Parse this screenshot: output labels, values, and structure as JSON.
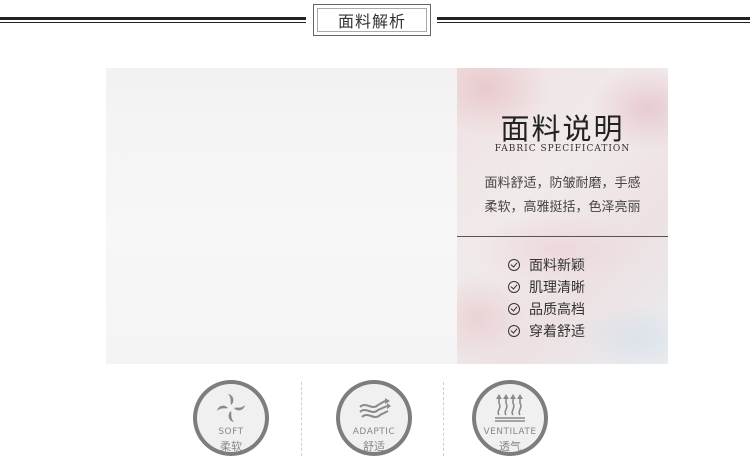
{
  "header": {
    "title": "面料解析"
  },
  "spec": {
    "title": "面料说明",
    "subtitle": "FABRIC SPECIFICATION",
    "desc_line1": "面料舒适，防皱耐磨，手感",
    "desc_line2": "柔软，高雅挺括，色泽亮丽",
    "features": [
      "面料新颖",
      "肌理清晰",
      "品质高档",
      "穿着舒适"
    ]
  },
  "badges": [
    {
      "icon": "soft-icon",
      "en": "SOFT",
      "zh": "柔软"
    },
    {
      "icon": "adaptic-icon",
      "en": "ADAPTIC",
      "zh": "舒适"
    },
    {
      "icon": "ventilate-icon",
      "en": "VENTILATE",
      "zh": "透气"
    }
  ],
  "colors": {
    "rule": "#222222",
    "badge_ring": "#7d7d7d",
    "badge_bg": "#f0f0f0",
    "badge_text": "#888888"
  }
}
